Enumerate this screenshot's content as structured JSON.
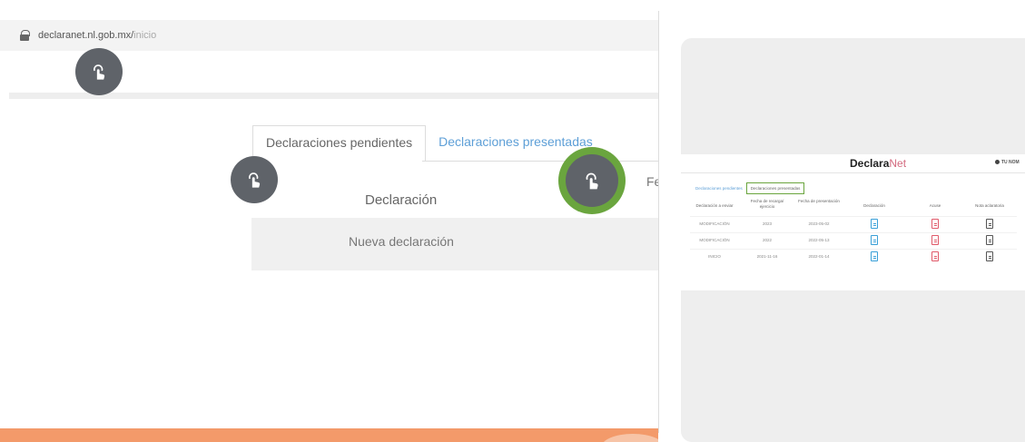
{
  "browser": {
    "url_host": "declaranet.nl.gob.mx/",
    "url_path": "inicio"
  },
  "left": {
    "tabs": [
      {
        "label": "Declaraciones pendientes"
      },
      {
        "label": "Declaraciones presentadas"
      }
    ],
    "col_partial": "Fe",
    "column_header": "Declaración",
    "row_label": "Nueva declaración"
  },
  "right": {
    "brand": {
      "part1": "Declara",
      "part2": "Net"
    },
    "user_label": "TU NOM",
    "tabs": [
      {
        "label": "Declaraciones pendientes"
      },
      {
        "label": "Declaraciones presentadas"
      }
    ],
    "columns": [
      "Declaración a enviar",
      "Fecha de recarga/ ejercicio",
      "Fecha de presentación",
      "Declaración",
      "Acuse",
      "Nota aclaratoria"
    ],
    "rows": [
      {
        "tipo": "MODIFICACIÓN",
        "ejercicio": "2023",
        "presentacion": "2023-05-02"
      },
      {
        "tipo": "MODIFICACIÓN",
        "ejercicio": "2022",
        "presentacion": "2022-05-13"
      },
      {
        "tipo": "INICIO",
        "ejercicio": "2021-11-16",
        "presentacion": "2022-01-14"
      }
    ]
  },
  "colors": {
    "accent_green": "#6aa53e",
    "link_blue": "#5d9fd7",
    "orange_bar": "#f39a6a",
    "brand_pink": "#d36a7f"
  },
  "icons": [
    "lock-icon",
    "tap-gesture-icon",
    "document-icon"
  ]
}
